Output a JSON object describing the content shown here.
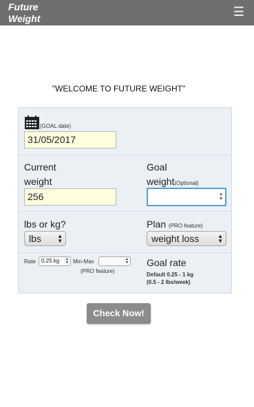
{
  "header": {
    "title": "Future Weight",
    "menu_icon": "hamburger-icon"
  },
  "welcome_text": "\"WELCOME TO FUTURE WEIGHT\"",
  "form": {
    "goal_date": {
      "label": "(GOAL date)",
      "value": "31/05/2017"
    },
    "current_weight": {
      "label_line1": "Current",
      "label_line2": "weight",
      "value": "256"
    },
    "goal_weight": {
      "label_line1": "Goal",
      "label_line2": "weight",
      "optional": "(Optional)",
      "value": ""
    },
    "units": {
      "label": "lbs or kg?",
      "selected": "lbs"
    },
    "plan": {
      "label": "Plan",
      "pro_note": "(PRO feature)",
      "selected": "weight loss"
    },
    "rate": {
      "label": "Rate",
      "selected": "0.25 kg",
      "minmax_label": "Min-Max",
      "minmax_pro": "(PRO feature)"
    },
    "goal_rate": {
      "label": "Goal rate",
      "default_line1": "Default 0.25 - 1 kg",
      "default_line2": "(0.5 - 2 lbs/week)"
    }
  },
  "check_button": "Check Now!"
}
